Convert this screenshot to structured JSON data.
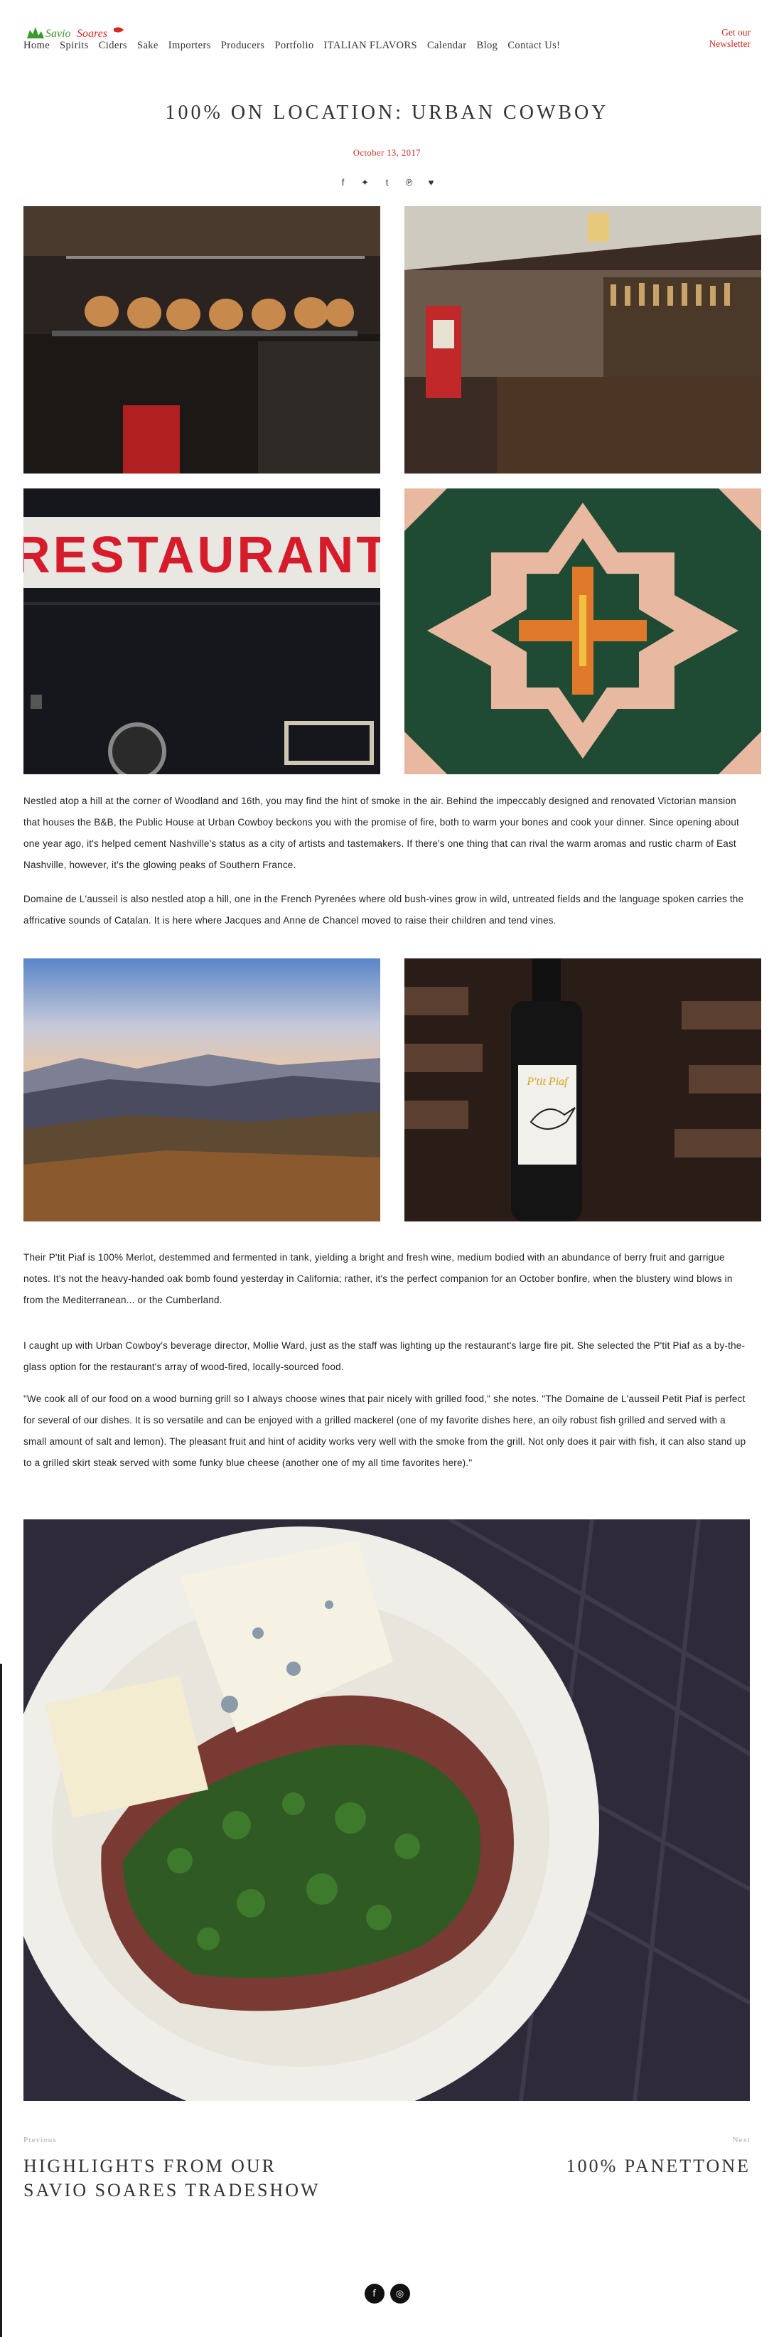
{
  "header": {
    "logo_text": "Savio Soares",
    "nav": [
      "Home",
      "Spirits",
      "Ciders",
      "Sake",
      "Importers",
      "Producers",
      "Portfolio",
      "ITALIAN FLAVORS",
      "Calendar",
      "Blog",
      "Contact Us!"
    ],
    "newsletter_line1": "Get our",
    "newsletter_line2": "Newsletter"
  },
  "post": {
    "title": "100% ON LOCATION: URBAN COWBOY",
    "date": "October 13, 2017",
    "share_icons": [
      "facebook-icon",
      "twitter-icon",
      "tumblr-icon",
      "pinterest-icon",
      "heart-icon"
    ],
    "photo1_sign": "RESTAURANT",
    "bottle_label": "P'tit Piaf",
    "paragraphs": [
      "Nestled atop a hill at the corner of Woodland and 16th, you may find the hint of smoke in the air. Behind the impeccably designed and renovated Victorian mansion that houses the B&B, the Public House at Urban Cowboy beckons you with the promise of fire, both to warm your bones and cook your dinner. Since opening about one year ago, it's helped cement Nashville's status as a city of artists and tastemakers. If there's one thing that can rival the warm aromas and rustic charm of East Nashville, however, it's the glowing peaks of Southern France.",
      "Domaine de L'ausseil is also nestled atop a hill, one in the French Pyrenées where old bush-vines grow in wild, untreated fields and the language spoken carries the affricative sounds of Catalan. It is here where Jacques and Anne de Chancel moved to raise their children and tend vines.",
      "Their P'tit Piaf is 100% Merlot, destemmed and fermented in tank, yielding a bright and fresh wine, medium bodied with an abundance of berry fruit and garrigue notes. It's not the heavy-handed oak bomb found yesterday in California; rather, it's the perfect companion for an October bonfire, when the blustery wind blows in from the Mediterranean... or the Cumberland.",
      "I caught up with Urban Cowboy's beverage director, Mollie Ward, just as the staff was lighting up the restaurant's large fire pit. She selected the P'tit Piaf as a by-the-glass option for the restaurant's array of wood-fired, locally-sourced food.",
      "\"We cook all of our food on a wood burning grill so I always choose wines that pair nicely with grilled food,\" she notes. \"The Domaine de L'ausseil Petit Piaf is perfect for several of our dishes. It is so versatile and can be enjoyed with a grilled mackerel (one of my favorite dishes here, an oily robust fish grilled and served with a small amount of salt and lemon). The pleasant fruit and hint of acidity works very well with the smoke from the grill. Not only does it pair with fish, it can also stand up to a grilled skirt steak served with some funky blue cheese (another one of my all time favorites here).\""
    ]
  },
  "postnav": {
    "prev_label": "Previous",
    "prev_title_line1": "HIGHLIGHTS FROM OUR",
    "prev_title_line2": "SAVIO SOARES TRADESHOW",
    "next_label": "Next",
    "next_title": "100% PANETTONE"
  },
  "footer": {
    "social": [
      "facebook-icon",
      "instagram-icon"
    ]
  },
  "colors": {
    "accent": "#d82a20",
    "text": "#333333"
  }
}
